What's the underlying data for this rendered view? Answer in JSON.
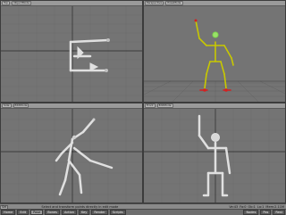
{
  "viewports": {
    "top_left": {
      "view": "Top",
      "mode": "ObjectMode"
    },
    "top_right": {
      "view": "Perspective",
      "mode": "PoseMode"
    },
    "bottom_left": {
      "view": "Side",
      "mode": "EditMode"
    },
    "bottom_right": {
      "view": "Front",
      "mode": "EditMode"
    }
  },
  "status": {
    "left_label": "Sel",
    "message": "Select and transform points directly in edit mode",
    "fields": [
      "Ve:43",
      "Fa:0",
      "Ob:1",
      "La:1",
      "Mem:2.11M"
    ]
  },
  "tabs": {
    "items": [
      "Home",
      "Edit",
      "Pose",
      "Bones",
      "Action",
      "Key",
      "Render",
      "Scripts"
    ],
    "active": "Pose",
    "right_buttons": [
      "Nodes",
      "Pos",
      "Rest"
    ]
  },
  "colors": {
    "bone_white": "#d6d6d6",
    "bone_selected": "#c8c800",
    "bone_active": "#7fd94c",
    "joint_red": "#d42020",
    "viewport_bg": "#747474"
  }
}
